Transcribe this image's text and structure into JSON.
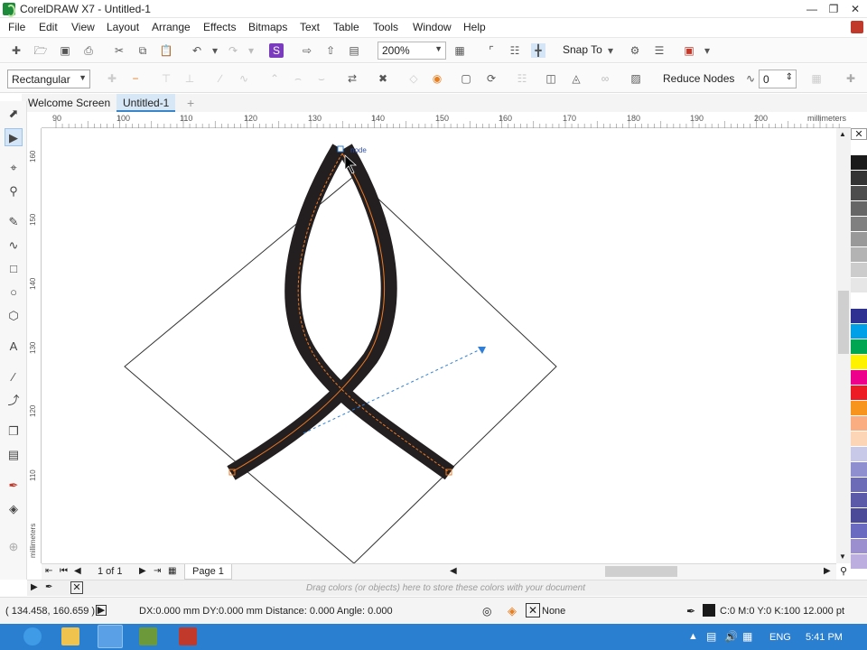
{
  "window": {
    "title": "CorelDRAW X7 - Untitled-1",
    "minimize_icon": "minimize-icon",
    "restore_icon": "restore-icon",
    "close_icon": "close-icon"
  },
  "menu": {
    "items": [
      "File",
      "Edit",
      "View",
      "Layout",
      "Arrange",
      "Effects",
      "Bitmaps",
      "Text",
      "Table",
      "Tools",
      "Window",
      "Help"
    ]
  },
  "standard_toolbar": {
    "zoom_level": "200%",
    "snap_to_label": "Snap To"
  },
  "property_bar": {
    "selection_mode": "Rectangular",
    "reduce_nodes_label": "Reduce Nodes",
    "curve_smoothness": "0"
  },
  "tabs": {
    "welcome": "Welcome Screen",
    "document": "Untitled-1"
  },
  "ruler": {
    "units": "millimeters",
    "horizontal_ticks": [
      "90",
      "100",
      "110",
      "120",
      "130",
      "140",
      "150",
      "160",
      "170",
      "180",
      "190",
      "200"
    ],
    "vertical_ticks": [
      "160",
      "150",
      "140",
      "130",
      "120",
      "110"
    ]
  },
  "canvas": {
    "snap_hint": "node",
    "stroke_color": "#231f20",
    "highlight_color": "#f07a22",
    "vector_color": "#2f7fd8"
  },
  "page_navigator": {
    "page_count": "1 of 1",
    "page_tab": "Page 1"
  },
  "color_hint": "Drag colors (or objects) here to store these colors with your document",
  "palette": [
    "#ffffff",
    "#1a1a1a",
    "#333333",
    "#4d4d4d",
    "#666666",
    "#808080",
    "#999999",
    "#b3b3b3",
    "#cccccc",
    "#e6e6e6",
    "#ffffff",
    "#2e3192",
    "#00a0e9",
    "#00a651",
    "#fff200",
    "#ec008c",
    "#ed1c24",
    "#f7941d",
    "#f9ad81",
    "#fbd5b5",
    "#c8c8e8",
    "#8f8fcf",
    "#6b6bb8",
    "#5a5aa8",
    "#4a4a98",
    "#6a6ac0",
    "#9b8fcf",
    "#bcaede"
  ],
  "status": {
    "cursor_position": "( 134.458, 160.659 )",
    "metrics": "DX:0.000 mm DY:0.000 mm Distance: 0.000 Angle: 0.000",
    "fill": "None",
    "outline": "C:0 M:0 Y:0 K:100  12.000 pt"
  },
  "taskbar": {
    "language": "ENG",
    "time": "5:41 PM"
  }
}
